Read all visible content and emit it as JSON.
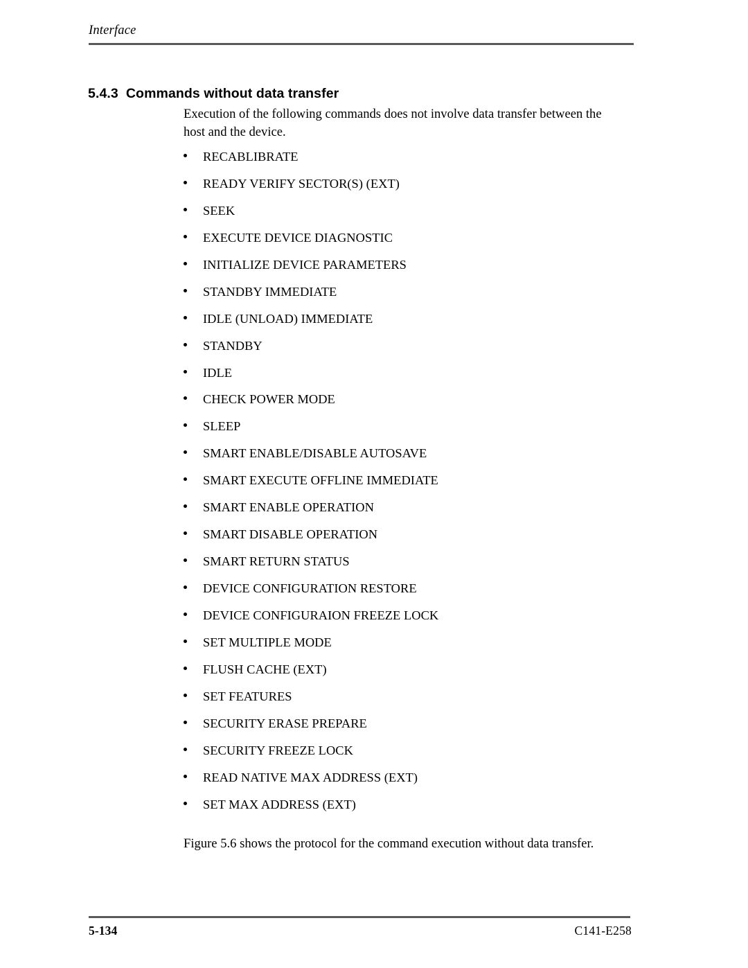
{
  "header": {
    "running_title": "Interface"
  },
  "section": {
    "number": "5.4.3",
    "title": "Commands without data transfer"
  },
  "intro": {
    "line1": "Execution of the following commands does not involve data transfer between the",
    "line2": "host and the device."
  },
  "commands": [
    {
      "label": "RECABLIBRATE"
    },
    {
      "label": "READY VERIFY SECTOR(S) (EXT)"
    },
    {
      "label": "SEEK"
    },
    {
      "label": "EXECUTE DEVICE DIAGNOSTIC"
    },
    {
      "label": "INITIALIZE DEVICE PARAMETERS"
    },
    {
      "label": "STANDBY IMMEDIATE"
    },
    {
      "label": "IDLE (UNLOAD) IMMEDIATE"
    },
    {
      "label": "STANDBY"
    },
    {
      "label": "IDLE"
    },
    {
      "label": "CHECK POWER MODE"
    },
    {
      "label": "SLEEP"
    },
    {
      "label": "SMART ENABLE/DISABLE AUTOSAVE"
    },
    {
      "label": "SMART EXECUTE OFFLINE IMMEDIATE"
    },
    {
      "label": "SMART ENABLE OPERATION"
    },
    {
      "label": "SMART DISABLE OPERATION"
    },
    {
      "label": "SMART RETURN STATUS"
    },
    {
      "label": "DEVICE CONFIGURATION RESTORE"
    },
    {
      "label": "DEVICE CONFIGURAION FREEZE LOCK"
    },
    {
      "label": "SET MULTIPLE MODE"
    },
    {
      "label": "FLUSH CACHE (EXT)"
    },
    {
      "label": "SET FEATURES"
    },
    {
      "label": "SECURITY ERASE PREPARE"
    },
    {
      "label": "SECURITY FREEZE LOCK"
    },
    {
      "label": "READ NATIVE MAX ADDRESS (EXT)"
    },
    {
      "label": "SET MAX ADDRESS (EXT)"
    }
  ],
  "closing": {
    "text": "Figure 5.6 shows the protocol for the command execution without data transfer."
  },
  "footer": {
    "page_number": "5-134",
    "document_code": "C141-E258"
  }
}
